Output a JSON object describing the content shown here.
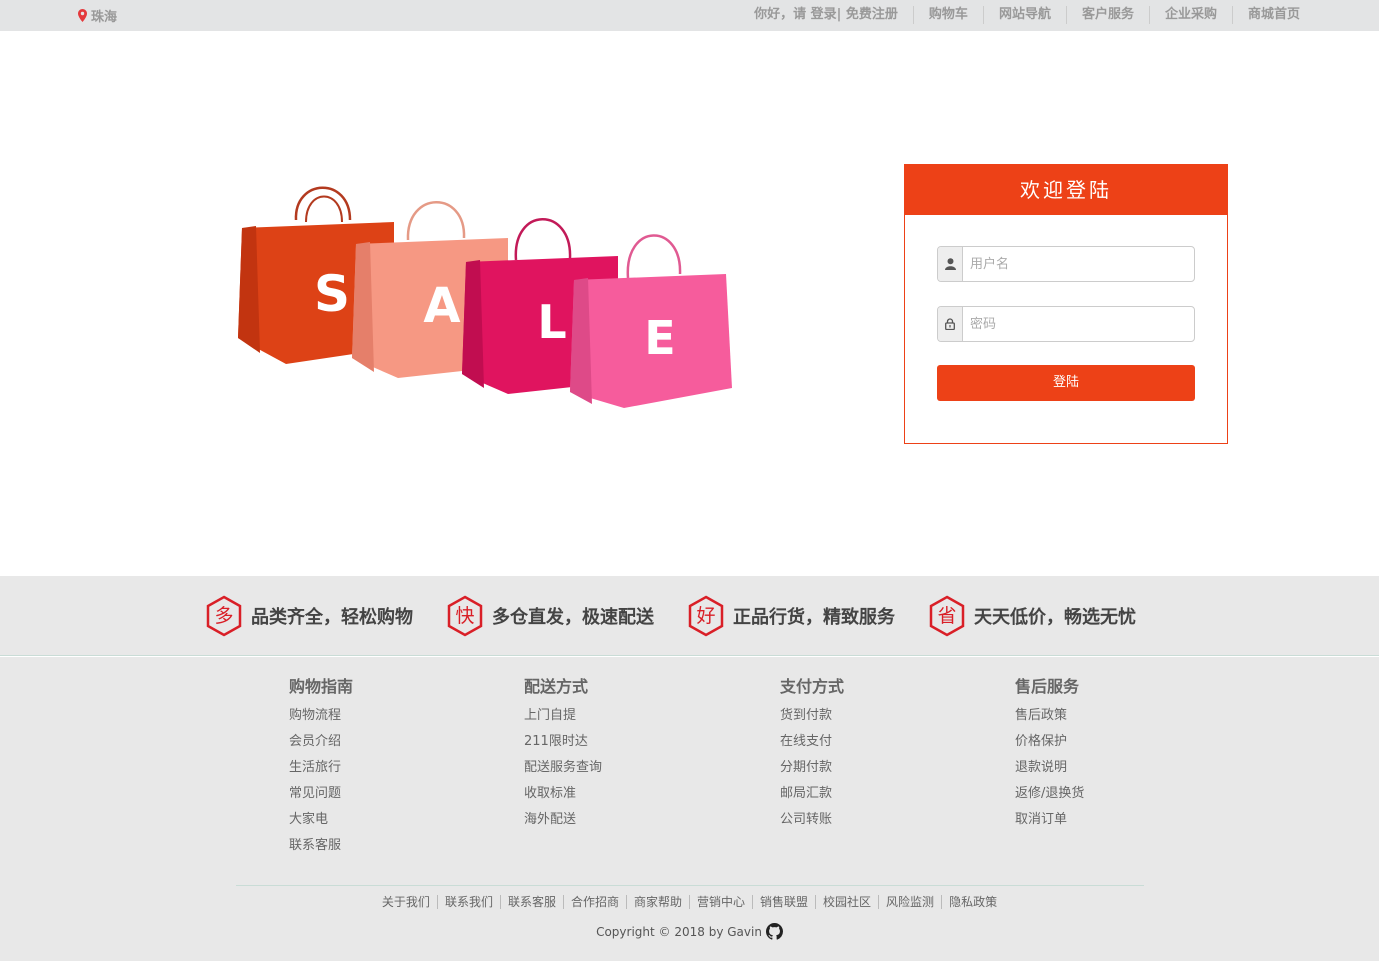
{
  "topbar": {
    "location": "珠海",
    "greeting": "你好，请 登录| 免费注册",
    "nav": [
      "购物车",
      "网站导航",
      "客户服务",
      "企业采购",
      "商城首页"
    ]
  },
  "sale_letters": [
    "S",
    "A",
    "L",
    "E"
  ],
  "login": {
    "title": "欢迎登陆",
    "username_placeholder": "用户名",
    "password_placeholder": "密码",
    "submit_label": "登陆"
  },
  "features": [
    {
      "icon_char": "多",
      "text": "品类齐全，轻松购物"
    },
    {
      "icon_char": "快",
      "text": "多仓直发，极速配送"
    },
    {
      "icon_char": "好",
      "text": "正品行货，精致服务"
    },
    {
      "icon_char": "省",
      "text": "天天低价，畅选无忧"
    }
  ],
  "footer_columns": [
    {
      "title": "购物指南",
      "items": [
        "购物流程",
        "会员介绍",
        "生活旅行",
        "常见问题",
        "大家电",
        "联系客服"
      ]
    },
    {
      "title": "配送方式",
      "items": [
        "上门自提",
        "211限时达",
        "配送服务查询",
        "收取标准",
        "海外配送"
      ]
    },
    {
      "title": "支付方式",
      "items": [
        "货到付款",
        "在线支付",
        "分期付款",
        "邮局汇款",
        "公司转账"
      ]
    },
    {
      "title": "售后服务",
      "items": [
        "售后政策",
        "价格保护",
        "退款说明",
        "返修/退换货",
        "取消订单"
      ]
    }
  ],
  "bottom_links": [
    "关于我们",
    "联系我们",
    "联系客服",
    "合作招商",
    "商家帮助",
    "营销中心",
    "销售联盟",
    "校园社区",
    "风险监测",
    "隐私政策"
  ],
  "copyright": "Copyright © 2018 by Gavin",
  "colors": {
    "accent": "#ed4117",
    "feature_icon": "#d91f27",
    "topbar_bg": "#e3e4e5",
    "footer_bg": "#e8e8e8"
  }
}
